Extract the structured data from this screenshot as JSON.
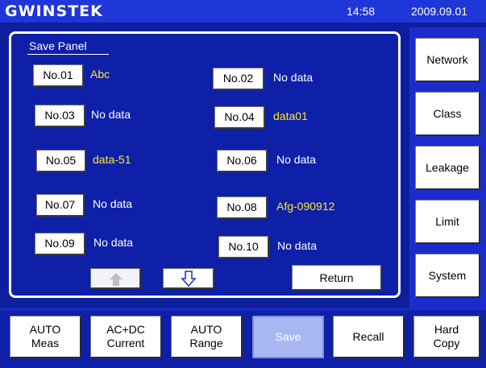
{
  "header": {
    "logo": "GWINSTEK",
    "time": "14:58",
    "date": "2009.09.01"
  },
  "panel": {
    "title": "Save Panel",
    "slots": [
      {
        "button": "No.01",
        "label": "Abc",
        "color": "#ffea2a"
      },
      {
        "button": "No.02",
        "label": "No data",
        "color": "#ffffff"
      },
      {
        "button": "No.03",
        "label": "No data",
        "color": "#ffffff"
      },
      {
        "button": "No.04",
        "label": "data01",
        "color": "#ffea2a"
      },
      {
        "button": "No.05",
        "label": "data-51",
        "color": "#ffea2a"
      },
      {
        "button": "No.06",
        "label": "No data",
        "color": "#ffffff"
      },
      {
        "button": "No.07",
        "label": "No data",
        "color": "#ffffff"
      },
      {
        "button": "No.08",
        "label": "Afg-090912",
        "color": "#ffea2a"
      },
      {
        "button": "No.09",
        "label": "No data",
        "color": "#ffffff"
      },
      {
        "button": "No.10",
        "label": "No data",
        "color": "#ffffff"
      }
    ],
    "up_icon": "arrow-up-icon",
    "down_icon": "arrow-down-icon",
    "return_label": "Return"
  },
  "sidebar": {
    "items": [
      {
        "label": "Network"
      },
      {
        "label": "Class"
      },
      {
        "label": "Leakage"
      },
      {
        "label": "Limit"
      },
      {
        "label": "System"
      }
    ]
  },
  "bottom": {
    "items": [
      {
        "label": "AUTO\nMeas"
      },
      {
        "label": "AC+DC\nCurrent"
      },
      {
        "label": "AUTO\nRange"
      },
      {
        "label": "Save",
        "active": true
      },
      {
        "label": "Recall"
      },
      {
        "label": "Hard\nCopy"
      }
    ]
  },
  "colors": {
    "background": "#0e1fa8",
    "topbar": "#1f36d8",
    "highlight_text": "#ffea2a",
    "active_button": "#a9b7f2"
  }
}
